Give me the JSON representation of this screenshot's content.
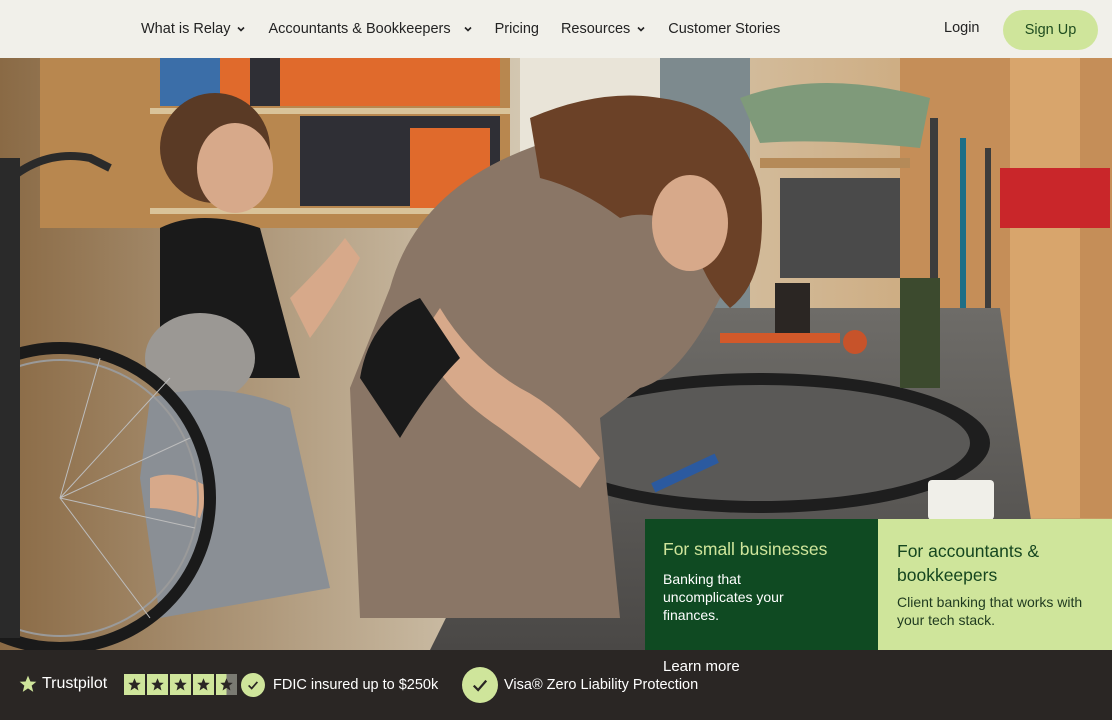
{
  "nav": {
    "items": [
      {
        "label": "What is Relay",
        "has_dropdown": true
      },
      {
        "label": "Accountants & Bookkeepers",
        "has_dropdown": true
      },
      {
        "label": "Pricing",
        "has_dropdown": false
      },
      {
        "label": "Resources",
        "has_dropdown": true
      },
      {
        "label": "Customer Stories",
        "has_dropdown": false
      }
    ],
    "login": "Login",
    "signup": "Sign Up"
  },
  "cards": {
    "small_business": {
      "title": "For small businesses",
      "description": "Banking that uncomplicates your finances."
    },
    "accountants": {
      "title": "For accountants & bookkeepers",
      "description": "Client banking that works with your tech stack."
    }
  },
  "footer": {
    "learn_more": "Learn more",
    "trustpilot": "Trustpilot",
    "rating_stars": 4.5,
    "fdic": "FDIC insured up to $250k",
    "visa": "Visa® Zero Liability Protection"
  },
  "colors": {
    "accent_lime": "#cfe59b",
    "dark_green": "#0f4a22",
    "footer_bg": "#2a2624",
    "nav_bg": "#f1f0ea"
  }
}
